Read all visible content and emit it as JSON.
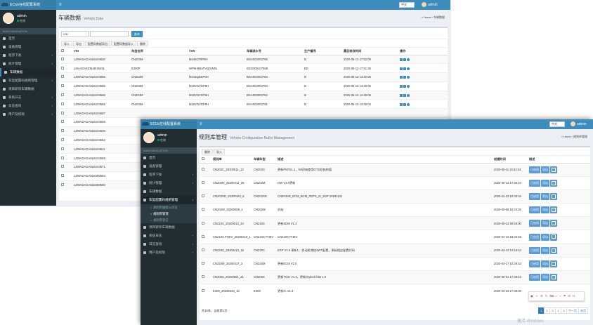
{
  "app_title": "ECUs在线配置系统",
  "user": {
    "name": "admin",
    "status": "在线"
  },
  "lang_select": "中文",
  "nav_search": "MAIN NAVIGATION",
  "back": {
    "nav": [
      {
        "label": "首页",
        "chevron": false
      },
      {
        "label": "设备管理",
        "chevron": false
      },
      {
        "label": "程序下发",
        "chevron": true
      },
      {
        "label": "统计管理",
        "chevron": true
      },
      {
        "label": "车辆数据",
        "chevron": false
      },
      {
        "label": "车型配置码规则管理",
        "chevron": true
      },
      {
        "label": "项目新项车辆数据",
        "chevron": false
      },
      {
        "label": "系统日志",
        "chevron": true
      },
      {
        "label": "日志查询",
        "chevron": true
      },
      {
        "label": "用户及权限",
        "chevron": true
      }
    ],
    "page_title": "车辆数据",
    "page_subtitle": "Vehicle Data",
    "breadcrumb": [
      "Home",
      "车辆数据"
    ],
    "filter": {
      "field": "VIN",
      "search_label": "查询"
    },
    "toolbar": [
      "导入",
      "导出",
      "配置码数据导出",
      "配置码数据导入",
      "删除"
    ],
    "columns": [
      "",
      "VIN",
      "车型名称",
      "VSN",
      "车辆流水号",
      "生产编号",
      "最后修改时间",
      "操作"
    ],
    "rows": [
      [
        "LZWADAGA8LB104630",
        "CN202M",
        "M245CF6P8H",
        "BGA002003795",
        "B",
        "2020-05-13 17:52:09"
      ],
      [
        "LMAADAEZ8LB045451",
        "E300P",
        "WP5H9B1PVQGW91",
        "BDG000107568",
        "BD",
        "2020-05-13 17:51:38"
      ],
      [
        "LZWADAGA8LB104656",
        "CN202M",
        "M215QDSP8H",
        "BGA002003784",
        "B",
        "2020-05-13 14:32:06"
      ],
      [
        "LZWADAGA8LB104585",
        "CN202M",
        "M20VDVGP8H",
        "BGA002003793",
        "B",
        "2020-05-13 14:30:05"
      ],
      [
        "LZWADAGA8LB104596",
        "CN202M",
        "M20VDVGP8H",
        "BGA002003792",
        "B",
        "2020-05-13 14:30:06"
      ],
      [
        "LZWADAGA8LB104566",
        "CN202M",
        "M20VDVGP8H",
        "BGA002003791",
        "B",
        "2020-05-13 14:28:04"
      ],
      [
        "LZWADAGA8LB104607",
        "",
        "",
        "",
        "",
        ""
      ],
      [
        "LZWADAGA8LB104608",
        "",
        "",
        "",
        "",
        ""
      ],
      [
        "LZWADAGA8LB104636",
        "",
        "",
        "",
        "",
        ""
      ],
      [
        "LZWADAGA8LB104552",
        "",
        "",
        "",
        "",
        ""
      ],
      [
        "LZWADAGA8LB104611",
        "",
        "",
        "",
        "",
        ""
      ],
      [
        "LZWADAGA8LB104558",
        "",
        "",
        "",
        "",
        ""
      ],
      [
        "LZWADAGA8LB104571",
        "",
        "",
        "",
        "",
        ""
      ],
      [
        "LZWADAGA8LB460584",
        "",
        "",
        "",
        "",
        ""
      ],
      [
        "LZWADAGA8LB460580",
        "",
        "",
        "",
        "",
        ""
      ]
    ]
  },
  "front": {
    "nav": [
      {
        "label": "首页",
        "chevron": false,
        "state": ""
      },
      {
        "label": "设备管理",
        "chevron": false,
        "state": ""
      },
      {
        "label": "程序下发",
        "chevron": true,
        "state": ""
      },
      {
        "label": "统计管理",
        "chevron": true,
        "state": ""
      },
      {
        "label": "车辆数据",
        "chevron": false,
        "state": ""
      },
      {
        "label": "车型配置码规则管理",
        "chevron": true,
        "state": "open"
      }
    ],
    "subnav": [
      {
        "label": "规则库编辑与浏览",
        "current": false
      },
      {
        "label": "规则库管理",
        "current": true
      },
      {
        "label": "规则库登记",
        "current": false
      }
    ],
    "nav_after": [
      {
        "label": "项目新项车辆数据",
        "chevron": false
      },
      {
        "label": "系统日志",
        "chevron": true
      },
      {
        "label": "日志查询",
        "chevron": true
      },
      {
        "label": "用户及权限",
        "chevron": true
      }
    ],
    "page_title": "规则库管理",
    "page_subtitle": "Vehicle Configuration Rules Management",
    "breadcrumb": [
      "Home",
      "规则库管理"
    ],
    "toolbar": [
      "删除",
      "导入"
    ],
    "columns": [
      "",
      "规则库",
      "车辆车型",
      "描述",
      "创建时间",
      "描述"
    ],
    "row_buttons": [
      "已启用",
      "导出"
    ],
    "rows": [
      [
        "CN202C_20200511_13",
        "CN202C",
        "更新PEPS1.1，N0初始使用OTS初始的值",
        "2020-05-11 10:42:44"
      ],
      [
        "CN202M_20200412_28",
        "CN202M",
        "GW V2.0更新",
        "2020-05-12 17:30:24"
      ],
      [
        "CN202SR_20200423_9",
        "CN202SR",
        "CN202SR_ECM_BCM_PEPS_IC_ESP 20191101",
        "2020-04-23 16:35:16"
      ],
      [
        "CN202W_20200008_1",
        "CN202W",
        "初始",
        "2020-05-08 16:23:25"
      ],
      [
        "CN210S_20200013_34",
        "CN210S",
        "更新SDM V1.4",
        "2020-05-13 09:59:00"
      ],
      [
        "CN210S PHEV_20200410_1",
        "CN210S PHEV",
        "CN210S PHEV",
        "2020-04-10 18:26:03"
      ],
      [
        "CN220C_20200413_16",
        "CN220C",
        "ESP V1.6 更新1，发动机增加2WT配置，更新相应配置代码",
        "2020-04-13 14:16:43"
      ],
      [
        "CN220M_20200417_3",
        "CN220M",
        "更新ECM V2.0",
        "2020-04-17 10:29:43"
      ],
      [
        "CN300S_20200501_21",
        "CN300S",
        "更新TICE V1.3，更新Style10 bit2 1.0",
        "2020-05-01 17:39:42"
      ],
      [
        "E300_20200423_16",
        "E300",
        "更新IC V1.3",
        "2020-04-23 17:38:30"
      ]
    ],
    "pager_info": "共16条，当前第1页",
    "pages": [
      "1",
      "2",
      "3",
      "4",
      "5",
      "下一页",
      "末页"
    ],
    "watermark": "激活 Windows"
  },
  "colors": {
    "topbar": "#3c8dbc",
    "sidebar": "#222d32",
    "button": "#5b9bd5"
  }
}
